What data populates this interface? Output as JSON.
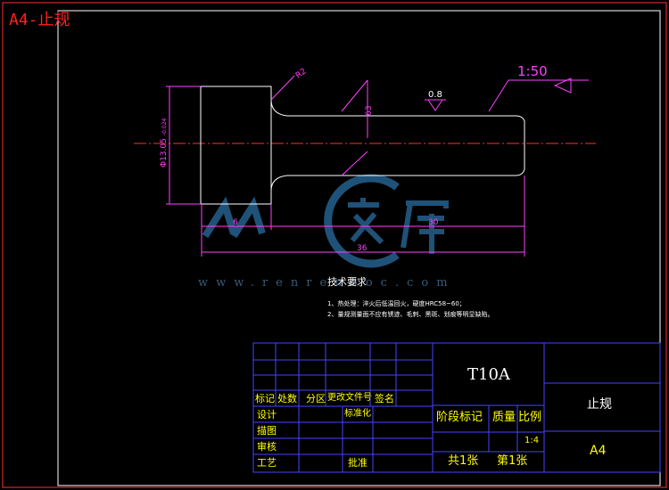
{
  "sheet": {
    "title": "A4-止规"
  },
  "drawing": {
    "scale_note": "1:50",
    "roughness_value": "0.8",
    "radius_label": "R2",
    "diameter_label": "Φ13.05",
    "diameter_tolerance": "-0.024",
    "dim_chamfer": "63",
    "dim_head_length": "6",
    "dim_shank_length": "30",
    "dim_total_length": "36"
  },
  "watermark": {
    "logo_text": "人人文库",
    "url_text": "www.renrendoc.com"
  },
  "tech_requirements": {
    "title": "技术要求",
    "items": [
      "1、热处理：淬火后低温回火，硬度HRC58~60；",
      "2、量规测量面不应有锈迹、毛刺、黑斑、划痕等明显缺陷。"
    ]
  },
  "title_block": {
    "material": "T10A",
    "part_name": "止规",
    "paper_size": "A4",
    "headers": [
      "标记",
      "处数",
      "分区",
      "更改文件号",
      "签名"
    ],
    "rows": [
      "设计",
      "描图",
      "审核",
      "工艺"
    ],
    "standardization": "标准化",
    "approve": "批准",
    "stage_mark": "阶段标记",
    "weight": "质量",
    "scale_label": "比例",
    "scale_value": "1:4",
    "total_sheets": "共1张",
    "sheet_no": "第1张"
  },
  "colors": {
    "background": "#000000",
    "outline": "#ffffff",
    "dimension": "#ff40ff",
    "centerline": "#ff3030",
    "title_block_lines": "#4444ff",
    "title_block_text": "#ffff00",
    "sheet_title": "#ff2020",
    "watermark": "#2a6ea0"
  }
}
